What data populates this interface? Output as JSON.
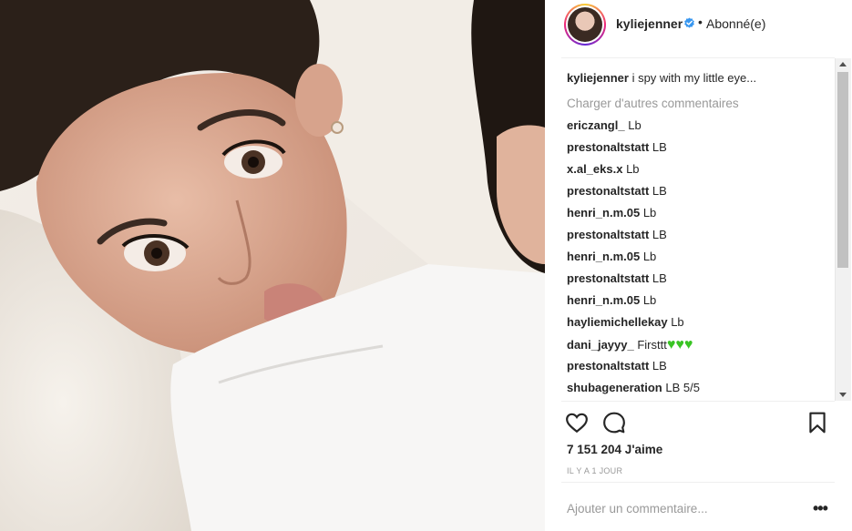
{
  "post": {
    "username": "kyliejenner",
    "separator": "•",
    "follow_status": "Abonné(e)",
    "caption_user": "kyliejenner",
    "caption_text": "i spy with my little eye...",
    "load_more": "Charger d'autres commentaires",
    "likes": "7 151 204 J'aime",
    "time": "IL Y A 1 JOUR",
    "add_comment_placeholder": "Ajouter un commentaire...",
    "more_options": "•••"
  },
  "comments": [
    {
      "user": "ericzangl_",
      "text": "Lb"
    },
    {
      "user": "prestonaltstatt",
      "text": "LB"
    },
    {
      "user": "x.al_eks.x",
      "text": "Lb"
    },
    {
      "user": "prestonaltstatt",
      "text": "LB"
    },
    {
      "user": "henri_n.m.05",
      "text": "Lb"
    },
    {
      "user": "prestonaltstatt",
      "text": "LB"
    },
    {
      "user": "henri_n.m.05",
      "text": "Lb"
    },
    {
      "user": "prestonaltstatt",
      "text": "LB"
    },
    {
      "user": "henri_n.m.05",
      "text": "Lb"
    },
    {
      "user": "hayliemichellekay",
      "text": "Lb"
    },
    {
      "user": "dani_jayyy_",
      "text": "Firsttt💚💚💚"
    },
    {
      "user": "prestonaltstatt",
      "text": "LB"
    },
    {
      "user": "shubageneration",
      "text": "LB 5/5"
    }
  ],
  "icons": {
    "verified": "verified-badge-icon",
    "like": "heart-icon",
    "comment": "comment-bubble-icon",
    "save": "bookmark-icon"
  },
  "colors": {
    "verified_blue": "#3897f0",
    "text": "#262626",
    "muted": "#999999",
    "heart_emoji": "#39c424"
  }
}
